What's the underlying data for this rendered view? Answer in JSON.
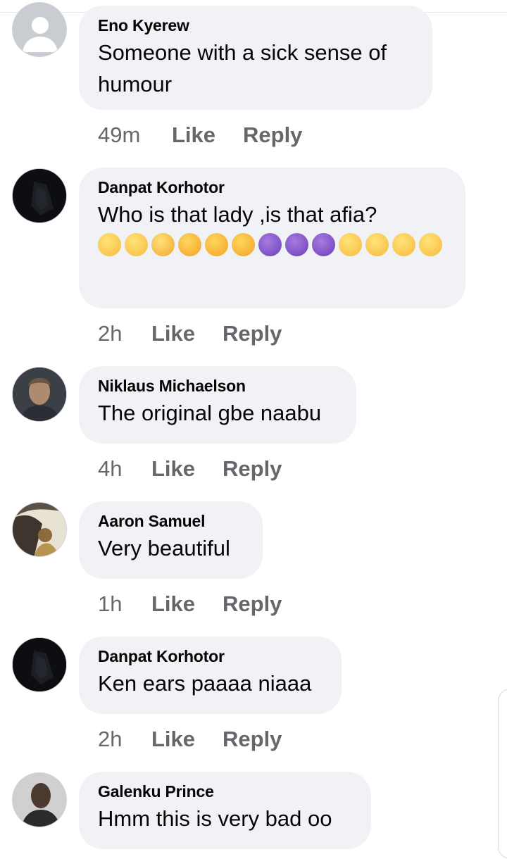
{
  "comments": [
    {
      "author": "Eno Kyerew",
      "text": "Someone with a sick sense of humour",
      "time": "49m",
      "avatar": "default-avatar-icon"
    },
    {
      "author": "Danpat Korhotor",
      "text": "Who is that lady ,is that afia?",
      "time": "2h",
      "avatar": "dark-photo-avatar",
      "emojis": [
        "face-with-rolling-eyes-icon",
        "zany-face-icon",
        "face-with-open-eyes-and-hand-over-mouth-icon",
        "rolling-on-the-floor-laughing-icon",
        "rolling-on-the-floor-laughing-icon",
        "rolling-on-the-floor-laughing-icon",
        "smiling-face-with-horns-icon",
        "smiling-face-with-horns-icon",
        "smiling-face-with-horns-icon",
        "grinning-face-icon",
        "grinning-face-icon",
        "grinning-face-icon",
        "grinning-face-icon"
      ]
    },
    {
      "author": "Niklaus Michaelson",
      "text": "The original gbe naabu",
      "time": "4h",
      "avatar": "man-photo-avatar"
    },
    {
      "author": "Aaron Samuel",
      "text": "Very beautiful",
      "time": "1h",
      "avatar": "landscape-photo-avatar"
    },
    {
      "author": "Danpat Korhotor",
      "text": "Ken ears paaaa niaaa",
      "time": "2h",
      "avatar": "dark-photo-avatar"
    },
    {
      "author": "Galenku Prince",
      "text": "Hmm this is very bad oo",
      "time": "",
      "avatar": "portrait-photo-avatar"
    }
  ],
  "actions": {
    "like_label": "Like",
    "reply_label": "Reply"
  },
  "colors": {
    "bubble": "#f0f2f5",
    "text": "#050505",
    "meta": "#65676b",
    "avatar_default": "#ccd0d5"
  }
}
